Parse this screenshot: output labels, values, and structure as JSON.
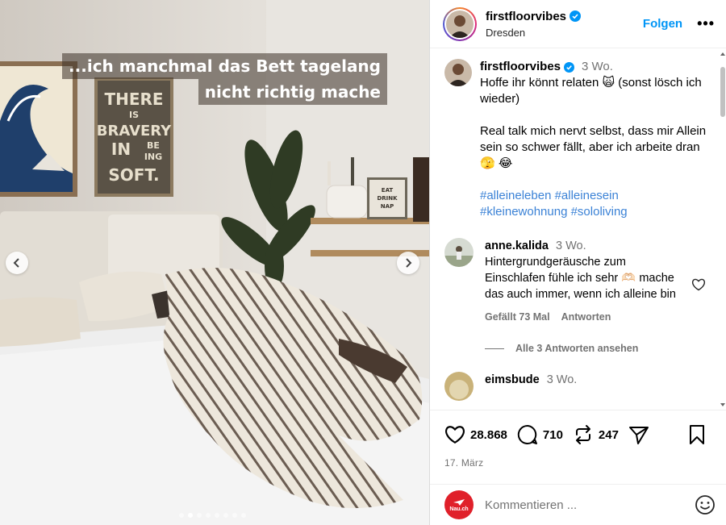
{
  "post": {
    "overlay_line1": "...ich manchmal das Bett tagelang",
    "overlay_line2": "nicht richtig mache",
    "poster_lines": [
      "THERE",
      "IS",
      "BRAVERY",
      "IN",
      "BE",
      "ING",
      "SOFT."
    ],
    "sign_lines": [
      "EAT",
      "DRINK",
      "NAP"
    ],
    "carousel": {
      "total": 8,
      "current": 2
    }
  },
  "header": {
    "username": "firstfloorvibes",
    "location": "Dresden",
    "follow_label": "Folgen",
    "more_label": "•••"
  },
  "caption": {
    "username": "firstfloorvibes",
    "time": "3 Wo.",
    "line1": "Hoffe ihr könnt relaten 🙀 (sonst lösch ich wieder)",
    "line2": "Real talk mich nervt selbst, dass mir Allein sein so schwer fällt, aber ich arbeite dran 🫣 😂",
    "hashtags": "#alleineleben #alleinesein #kleinewohnung #sololiving"
  },
  "comments": [
    {
      "username": "anne.kalida",
      "time": "3 Wo.",
      "text": "Hintergrundgeräusche zum Einschlafen fühle ich sehr 🫶🏻 mache das auch immer, wenn ich alleine bin",
      "likes": "Gefällt 73 Mal",
      "reply_label": "Antworten",
      "view_replies": "Alle 3 Antworten ansehen"
    },
    {
      "username": "eimsbude",
      "time": "3 Wo."
    }
  ],
  "actions": {
    "likes": "28.868",
    "comments": "710",
    "reposts": "247",
    "date": "17. März"
  },
  "add_comment": {
    "placeholder": "Kommentieren ...",
    "avatar_text": "Nau.ch"
  },
  "colors": {
    "link": "#0095f6",
    "hashtag": "#3b82d6",
    "verified": "#0095f6",
    "muted": "#737373"
  }
}
